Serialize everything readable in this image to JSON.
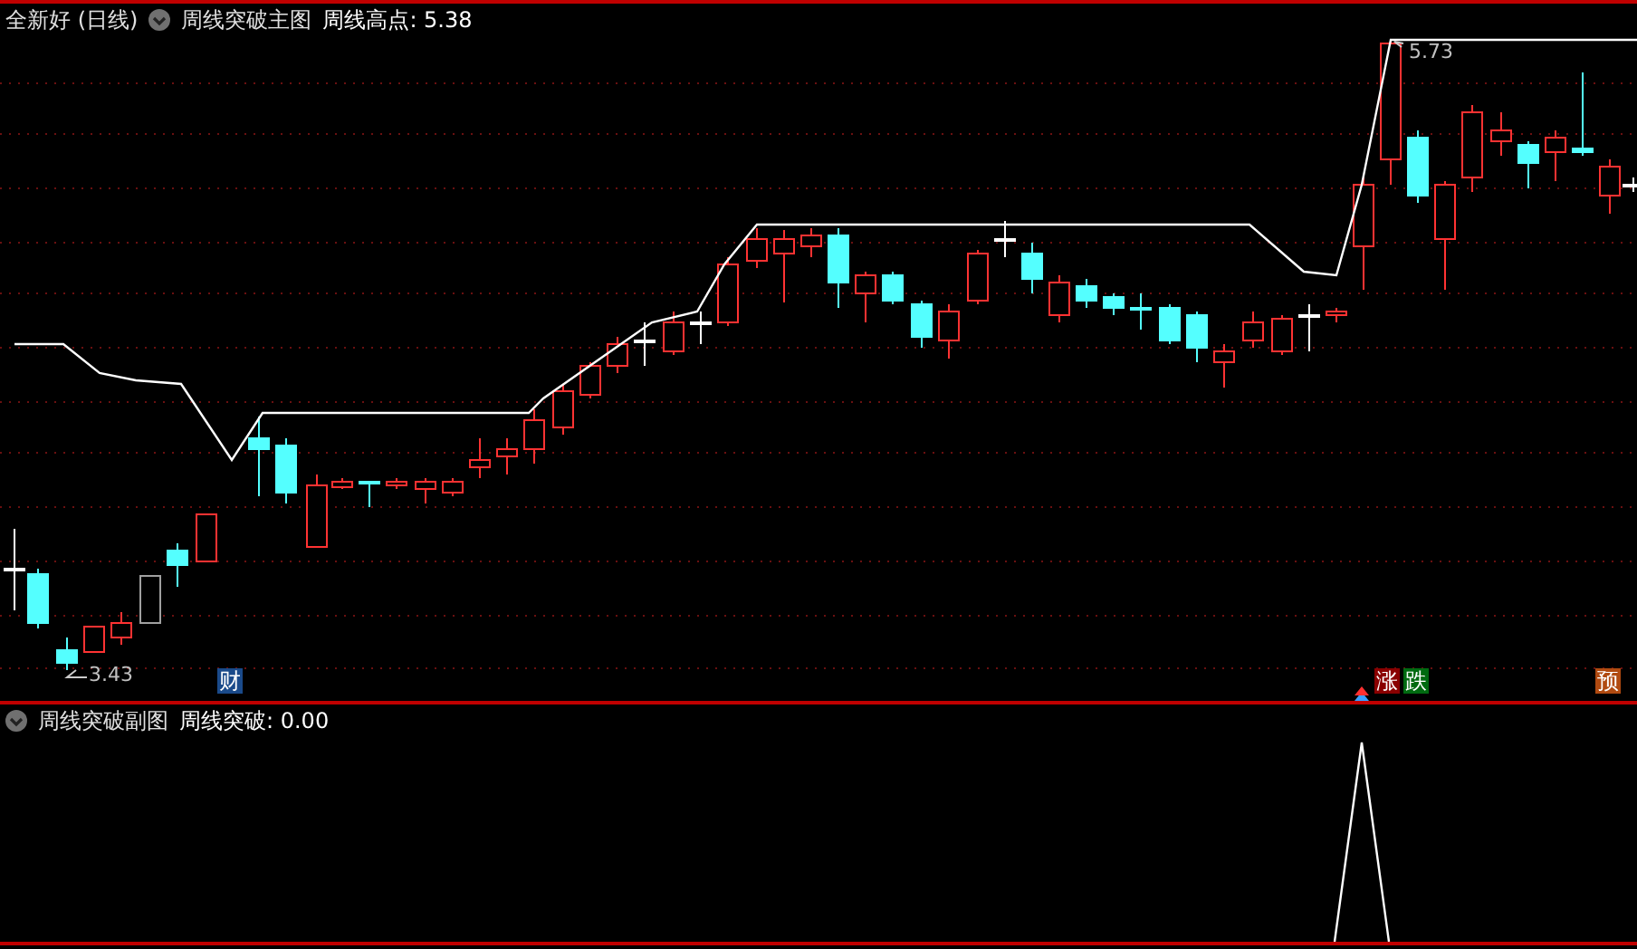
{
  "main": {
    "stock": "全新好 (日线)",
    "indicator": "周线突破主图",
    "readout": "周线高点: 5.38",
    "high_label": "5.73",
    "low_label": "3.43",
    "events": [
      {
        "kind": "finance",
        "text": "财"
      },
      {
        "kind": "rise",
        "text": "涨"
      },
      {
        "kind": "fall",
        "text": "跌"
      },
      {
        "kind": "forecast",
        "text": "预"
      }
    ]
  },
  "sub": {
    "indicator": "周线突破副图",
    "readout": "周线突破: 0.00"
  }
}
